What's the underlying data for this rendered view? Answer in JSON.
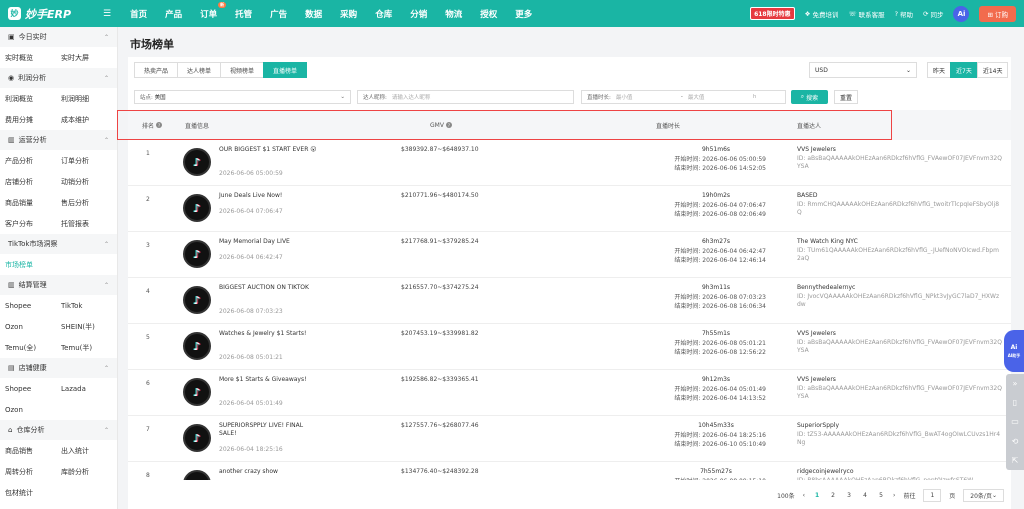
{
  "topbar": {
    "logo_mark": "妙",
    "logo_text": "妙手ERP",
    "nav": [
      "首页",
      "产品",
      "订单",
      "托管",
      "广告",
      "数据",
      "采购",
      "仓库",
      "分销",
      "物流",
      "授权",
      "更多"
    ],
    "hot_badge": "新",
    "promo": "618限时特惠",
    "tools": [
      "免费培训",
      "联系客服",
      "帮助",
      "同步"
    ],
    "ai": "Ai",
    "order_btn": "订购"
  },
  "sidebar": {
    "sec1": "今日实时",
    "s1a": "实时概览",
    "s1b": "实时大屏",
    "sec2": "利润分析",
    "s2a": "利润概览",
    "s2b": "利润明细",
    "s2c": "费用分摊",
    "s2d": "成本维护",
    "sec3": "运营分析",
    "s3a": "产品分析",
    "s3b": "订单分析",
    "s3c": "店铺分析",
    "s3d": "动销分析",
    "s3e": "商品销量",
    "s3f": "售后分析",
    "s3g": "客户分布",
    "s3h": "托管报表",
    "sec4": "TikTok市场洞察",
    "s4a": "市场榜单",
    "sec5": "结算管理",
    "s5a": "Shopee",
    "s5b": "TikTok",
    "s5c": "Ozon",
    "s5d": "SHEIN(半)",
    "s5e": "Temu(全)",
    "s5f": "Temu(半)",
    "sec6": "店铺健康",
    "s6a": "Shopee",
    "s6b": "Lazada",
    "s6c": "Ozon",
    "sec7": "仓库分析",
    "s7a": "商品销售",
    "s7b": "出入统计",
    "s7c": "周转分析",
    "s7d": "库龄分析",
    "s7e": "包材统计"
  },
  "page_title": "市场榜单",
  "tabs": [
    "热卖产品",
    "达人榜单",
    "视频榜单",
    "直播榜单"
  ],
  "currency": "USD",
  "ranges": [
    "昨天",
    "近7天",
    "近14天"
  ],
  "filters": {
    "site_label": "站点:",
    "site_value": "美国",
    "host_label": "达人昵称:",
    "host_ph": "请输入达人昵称",
    "dur_label": "直播时长:",
    "dur_min": "最小值",
    "dur_max": "最大值",
    "dur_unit": "h",
    "search": "搜索",
    "reset": "重置"
  },
  "headers": {
    "rank": "排名",
    "info": "直播信息",
    "gmv": "GMV",
    "duration": "直播时长",
    "host": "直播达人"
  },
  "labels": {
    "start": "开始时间:",
    "end": "结束时间:"
  },
  "rows": [
    {
      "rank": "1",
      "name": "OUR BIGGEST $1 START EVER 😮",
      "date": "2026-06-06 05:00:59",
      "gmv": "$389392.87~$648937.10",
      "dur": "9h51m6s",
      "start": "2026-06-06 05:00:59",
      "end": "2026-06-06 14:52:05",
      "host": "VVS Jewelers",
      "id": "ID: aBsBaQAAAAAkOHEzAan6RDkzf6hVflG_FVAewOF07JEVFnvm32QYSA"
    },
    {
      "rank": "2",
      "name": "June Deals Live Now!",
      "date": "2026-06-04 07:06:47",
      "gmv": "$210771.96~$480174.50",
      "dur": "19h0m2s",
      "start": "2026-06-04 07:06:47",
      "end": "2026-06-08 02:06:49",
      "host": "BASED",
      "id": "ID: RmmCHQAAAAAkOHEzAan6RDkzf6hVflG_twoitrTlcpqIeFSbyOlj8Q"
    },
    {
      "rank": "3",
      "name": "May Memorial Day LIVE",
      "date": "2026-06-04 06:42:47",
      "gmv": "$217768.91~$379285.24",
      "dur": "6h3m27s",
      "start": "2026-06-04 06:42:47",
      "end": "2026-06-04 12:46:14",
      "host": "The Watch King NYC",
      "id": "ID: TUm61QAAAAAkOHEzAan6RDkzf6hVflG_-JUefNoNVOIcwd.Fbpm2aQ"
    },
    {
      "rank": "4",
      "name": "BIGGEST AUCTION ON TIKTOK",
      "date": "2026-06-08 07:03:23",
      "gmv": "$216557.70~$374275.24",
      "dur": "9h3m11s",
      "start": "2026-06-08 07:03:23",
      "end": "2026-06-08 16:06:34",
      "host": "Bennythedealernyc",
      "id": "ID: JvocVQAAAAAkOHEzAan6RDkzf6hVflG_NPkt3vJyGC7laD7_HXWzdw"
    },
    {
      "rank": "5",
      "name": "Watches & Jewelry $1 Starts!",
      "date": "2026-06-08 05:01:21",
      "gmv": "$207453.19~$339981.82",
      "dur": "7h55m1s",
      "start": "2026-06-08 05:01:21",
      "end": "2026-06-08 12:56:22",
      "host": "VVS Jewelers",
      "id": "ID: aBsBaQAAAAAkOHEzAan6RDkzf6hVflG_FVAewOF07JEVFnvm32QYSA"
    },
    {
      "rank": "6",
      "name": "More $1 Starts & Giveaways!",
      "date": "2026-06-04 05:01:49",
      "gmv": "$192586.82~$339365.41",
      "dur": "9h12m3s",
      "start": "2026-06-04 05:01:49",
      "end": "2026-06-04 14:13:52",
      "host": "VVS Jewelers",
      "id": "ID: aBsBaQAAAAAkOHEzAan6RDkzf6hVflG_FVAewOF07JEVFnvm32QYSA"
    },
    {
      "rank": "7",
      "name": "SUPERIORSPPLY LIVE! FINAL SALE!",
      "date": "2026-06-04 18:25:16",
      "gmv": "$127557.76~$268077.46",
      "dur": "10h45m33s",
      "start": "2026-06-04 18:25:16",
      "end": "2026-06-10 05:10:49",
      "host": "SuperiorSpply",
      "id": "ID: tZ53-AAAAAAkOHEzAan6RDkzf6hVflG_BwAT4ogOIwLCUvzs1Hr4Ng"
    },
    {
      "rank": "8",
      "name": "another crazy show",
      "date": "2026-06-08 09:15:10",
      "gmv": "$134776.40~$248392.28",
      "dur": "7h55m27s",
      "start": "2026-06-08 09:15:10",
      "end": "",
      "host": "ridgecoinjewelryco",
      "id": "ID: B8bsAAAAAAkOHEzAan6RDkzf6hVflG_popt0IzwfsST6W"
    }
  ],
  "pager": {
    "total": "100条",
    "pages": [
      "1",
      "2",
      "3",
      "4",
      "5"
    ],
    "goto": "前往",
    "page_val": "1",
    "page_unit": "页",
    "size": "20条/页"
  },
  "float": {
    "ai": "Ai",
    "ai_label": "AI助手"
  }
}
